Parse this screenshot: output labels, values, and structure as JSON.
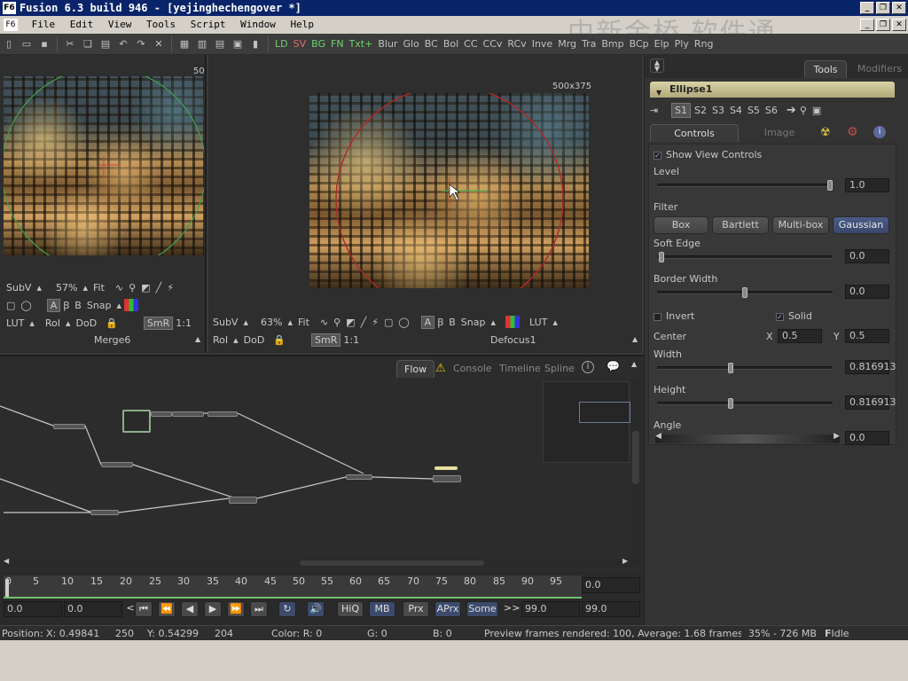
{
  "window": {
    "title": "Fusion 6.3 build 946 - [yejinghechengover *]",
    "icon": "F6",
    "watermark": "中新金桥 软件通"
  },
  "menu": [
    "File",
    "Edit",
    "View",
    "Tools",
    "Script",
    "Window",
    "Help"
  ],
  "toolbar": {
    "tools": [
      "LD",
      "SV",
      "BG",
      "FN",
      "Txt+",
      "Blur",
      "Glo",
      "BC",
      "Bol",
      "CC",
      "CCv",
      "RCv",
      "Inve",
      "Mrg",
      "Tra",
      "Bmp",
      "BCp",
      "Elp",
      "Ply",
      "Rng"
    ]
  },
  "viewer_left": {
    "size_label": "50",
    "subv": "SubV",
    "zoom": "57%",
    "fit": "Fit",
    "snap": "Snap",
    "lut": "LUT",
    "roi": "RoI",
    "dod": "DoD",
    "smr": "SmR",
    "ratio": "1:1",
    "name": "Merge6"
  },
  "viewer_right": {
    "size_label": "500x375",
    "subv": "SubV",
    "zoom": "63%",
    "fit": "Fit",
    "snap": "Snap",
    "lut": "LUT",
    "roi": "RoI",
    "dod": "DoD",
    "smr": "SmR",
    "ratio": "1:1",
    "name": "Defocus1"
  },
  "inspector": {
    "tabs": {
      "tools": "Tools",
      "modifiers": "Modifiers"
    },
    "tool_name": "Ellipse1",
    "slots": [
      "S1",
      "S2",
      "S3",
      "S4",
      "S5",
      "S6"
    ],
    "subtabs": {
      "controls": "Controls",
      "image": "Image"
    },
    "show_view_controls": "Show View Controls",
    "level": {
      "label": "Level",
      "value": "1.0",
      "fraction": 0.99
    },
    "filter": {
      "label": "Filter",
      "options": [
        "Box",
        "Bartlett",
        "Multi-box",
        "Gaussian"
      ],
      "selected": "Gaussian"
    },
    "soft_edge": {
      "label": "Soft Edge",
      "value": "0.0",
      "fraction": 0.0
    },
    "border_width": {
      "label": "Border Width",
      "value": "0.0",
      "fraction": 0.5
    },
    "invert": "Invert",
    "solid": "Solid",
    "center": {
      "label": "Center",
      "x_label": "X",
      "x": "0.5",
      "y_label": "Y",
      "y": "0.5"
    },
    "width": {
      "label": "Width",
      "value": "0.816913",
      "fraction": 0.41
    },
    "height": {
      "label": "Height",
      "value": "0.816913",
      "fraction": 0.41
    },
    "angle": {
      "label": "Angle",
      "value": "0.0"
    }
  },
  "flow": {
    "tabs": [
      "Flow",
      "Console",
      "Timeline",
      "Spline"
    ]
  },
  "timeline": {
    "ticks": [
      "0",
      "5",
      "10",
      "15",
      "20",
      "25",
      "30",
      "35",
      "40",
      "45",
      "50",
      "55",
      "60",
      "65",
      "70",
      "75",
      "80",
      "85",
      "90",
      "95"
    ],
    "current": "0.0",
    "start": "0.0",
    "render_start": "0.0",
    "render_end": "99.0",
    "end": "99.0",
    "buttons": [
      "HiQ",
      "MB",
      "Prx",
      "APrx",
      "Some"
    ],
    "arrow": ">>"
  },
  "status": {
    "position": "Position:",
    "x": "X: 0.49841",
    "px": "250",
    "y": "Y: 0.54299",
    "py": "204",
    "color_r": "Color: R: 0",
    "g": "G: 0",
    "b": "B: 0",
    "message": "Preview frames rendered: 100, Average: 1.68 frames/sec, T",
    "memory": "35% - 726 MB",
    "state": "Idle"
  },
  "colors": {
    "titlebar": "#0a246a",
    "accent": "#4a5c86",
    "header": "#d8d2a6"
  }
}
